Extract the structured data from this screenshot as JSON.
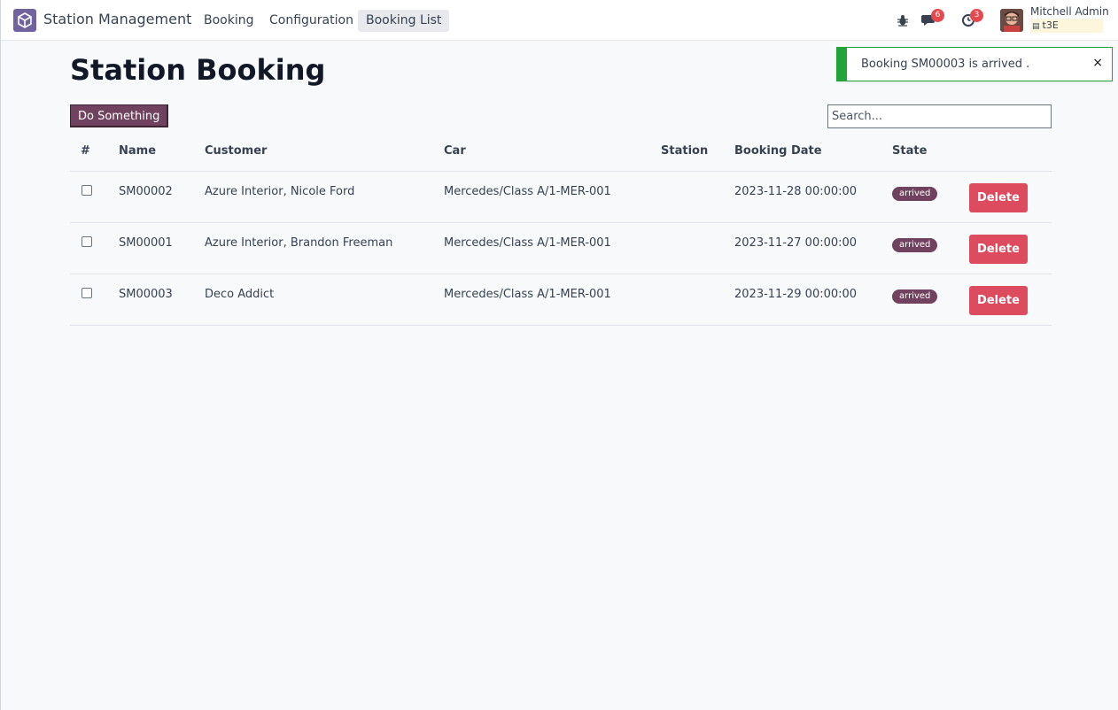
{
  "navbar": {
    "brand": "Station Management",
    "menu": [
      {
        "label": "Booking"
      },
      {
        "label": "Configuration"
      },
      {
        "label": "Booking List"
      }
    ],
    "messages_count": "6",
    "activities_count": "3",
    "user_name": "Mitchell Admin",
    "db_name": "t3E",
    "icons": [
      "debug-icon",
      "chat-icon",
      "clock-icon",
      "database-icon"
    ]
  },
  "page": {
    "title": "Station Booking",
    "action_button": "Do Something",
    "search_placeholder": "Search..."
  },
  "table": {
    "columns": [
      "#",
      "Name",
      "Customer",
      "Car",
      "Station",
      "Booking Date",
      "State"
    ],
    "rows": [
      {
        "name": "SM00002",
        "customer": "Azure Interior, Nicole Ford",
        "car": "Mercedes/Class A/1-MER-001",
        "station": "",
        "date": "2023-11-28 00:00:00",
        "state": "arrived",
        "action": "Delete"
      },
      {
        "name": "SM00001",
        "customer": "Azure Interior, Brandon Freeman",
        "car": "Mercedes/Class A/1-MER-001",
        "station": "",
        "date": "2023-11-27 00:00:00",
        "state": "arrived",
        "action": "Delete"
      },
      {
        "name": "SM00003",
        "customer": "Deco Addict",
        "car": "Mercedes/Class A/1-MER-001",
        "station": "",
        "date": "2023-11-29 00:00:00",
        "state": "arrived",
        "action": "Delete"
      }
    ]
  },
  "notification": {
    "message": "Booking SM00003 is arrived .",
    "close": "×"
  },
  "colors": {
    "primary": "#71425f",
    "danger": "#dc4c5e",
    "success": "#22a33a",
    "app_icon": "#71639e"
  }
}
